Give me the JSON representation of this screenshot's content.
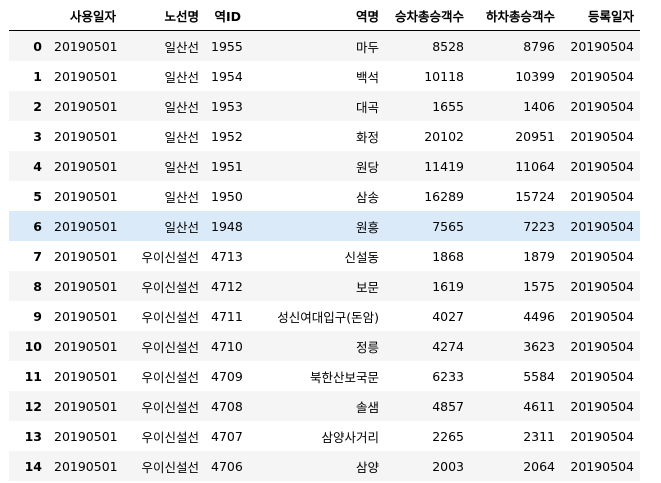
{
  "table": {
    "columns": [
      "",
      "사용일자",
      "노선명",
      "역ID",
      "역명",
      "승차총승객수",
      "하차총승객수",
      "등록일자"
    ],
    "highlight_row": 6,
    "rows": [
      [
        "0",
        "20190501",
        "일산선",
        "1955",
        "마두",
        "8528",
        "8796",
        "20190504"
      ],
      [
        "1",
        "20190501",
        "일산선",
        "1954",
        "백석",
        "10118",
        "10399",
        "20190504"
      ],
      [
        "2",
        "20190501",
        "일산선",
        "1953",
        "대곡",
        "1655",
        "1406",
        "20190504"
      ],
      [
        "3",
        "20190501",
        "일산선",
        "1952",
        "화정",
        "20102",
        "20951",
        "20190504"
      ],
      [
        "4",
        "20190501",
        "일산선",
        "1951",
        "원당",
        "11419",
        "11064",
        "20190504"
      ],
      [
        "5",
        "20190501",
        "일산선",
        "1950",
        "삼송",
        "16289",
        "15724",
        "20190504"
      ],
      [
        "6",
        "20190501",
        "일산선",
        "1948",
        "원흥",
        "7565",
        "7223",
        "20190504"
      ],
      [
        "7",
        "20190501",
        "우이신설선",
        "4713",
        "신설동",
        "1868",
        "1879",
        "20190504"
      ],
      [
        "8",
        "20190501",
        "우이신설선",
        "4712",
        "보문",
        "1619",
        "1575",
        "20190504"
      ],
      [
        "9",
        "20190501",
        "우이신설선",
        "4711",
        "성신여대입구(돈암)",
        "4027",
        "4496",
        "20190504"
      ],
      [
        "10",
        "20190501",
        "우이신설선",
        "4710",
        "정릉",
        "4274",
        "3623",
        "20190504"
      ],
      [
        "11",
        "20190501",
        "우이신설선",
        "4709",
        "북한산보국문",
        "6233",
        "5584",
        "20190504"
      ],
      [
        "12",
        "20190501",
        "우이신설선",
        "4708",
        "솔샘",
        "4857",
        "4611",
        "20190504"
      ],
      [
        "13",
        "20190501",
        "우이신설선",
        "4707",
        "삼양사거리",
        "2265",
        "2311",
        "20190504"
      ],
      [
        "14",
        "20190501",
        "우이신설선",
        "4706",
        "삼양",
        "2003",
        "2064",
        "20190504"
      ]
    ]
  }
}
